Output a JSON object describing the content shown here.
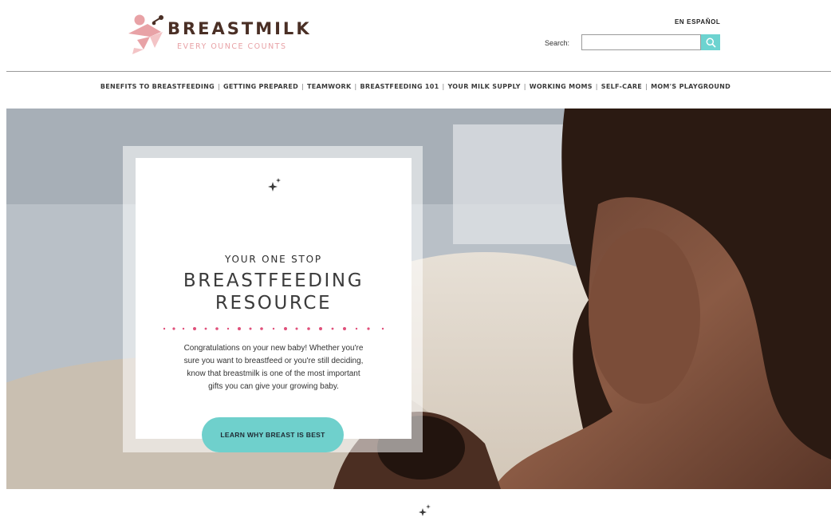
{
  "brand": {
    "title": "BREASTMILK",
    "tagline": "EVERY OUNCE COUNTS",
    "logo_icon": "breastfeeding-logo-icon"
  },
  "header": {
    "language_link": "EN ESPAÑOL",
    "search_label": "Search:",
    "search_value": "",
    "search_icon": "search-icon"
  },
  "nav": {
    "items": [
      "BENEFITS TO BREASTFEEDING",
      "GETTING PREPARED",
      "TEAMWORK",
      "BREASTFEEDING 101",
      "YOUR MILK SUPPLY",
      "WORKING MOMS",
      "SELF-CARE",
      "MOM'S PLAYGROUND"
    ]
  },
  "hero": {
    "kicker": "YOUR ONE STOP",
    "title_line1": "BREASTFEEDING",
    "title_line2": "RESOURCE",
    "body_line1": "Congratulations on your new baby! Whether you're",
    "body_line2": "sure you want to breastfeed or you're still deciding,",
    "body_line3": "know that breastmilk is one of the most important",
    "body_line4": "gifts you can give your growing baby.",
    "cta_label": "LEARN WHY BREAST IS BEST",
    "image_alt": "mother-holding-baby-photo"
  },
  "colors": {
    "accent_teal": "#6fd0cc",
    "brand_brown": "#4a2f25",
    "brand_pink": "#e8a2a6",
    "dot_pink": "#e0507a"
  }
}
